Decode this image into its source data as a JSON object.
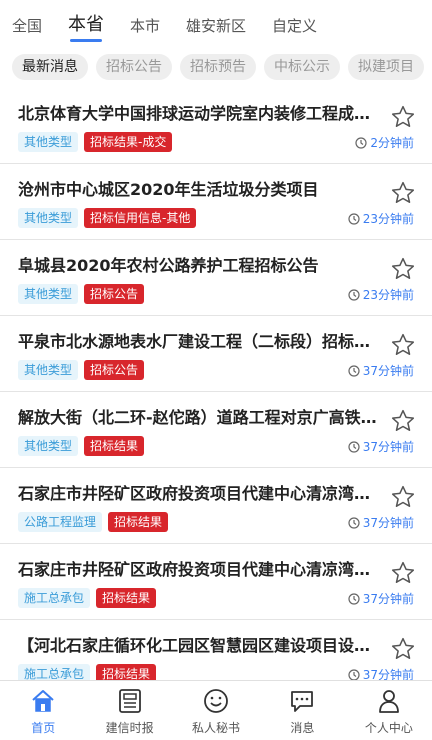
{
  "region_tabs": [
    {
      "label": "全国",
      "active": false
    },
    {
      "label": "本省",
      "active": true
    },
    {
      "label": "本市",
      "active": false
    },
    {
      "label": "雄安新区",
      "active": false
    },
    {
      "label": "自定义",
      "active": false
    }
  ],
  "categories": [
    {
      "label": "最新消息",
      "active": true
    },
    {
      "label": "招标公告",
      "active": false
    },
    {
      "label": "招标预告",
      "active": false
    },
    {
      "label": "中标公示",
      "active": false
    },
    {
      "label": "拟建项目",
      "active": false
    }
  ],
  "items": [
    {
      "title": "北京体育大学中国排球运动学院室内装修工程成交公告",
      "type_tag": "其他类型",
      "status_tag": "招标结果-成交",
      "time": "2分钟前"
    },
    {
      "title": "沧州市中心城区2020年生活垃圾分类项目",
      "type_tag": "其他类型",
      "status_tag": "招标信用信息-其他",
      "time": "23分钟前"
    },
    {
      "title": "阜城县2020年农村公路养护工程招标公告",
      "type_tag": "其他类型",
      "status_tag": "招标公告",
      "time": "23分钟前"
    },
    {
      "title": "平泉市北水源地表水厂建设工程（二标段）招标公告",
      "type_tag": "其他类型",
      "status_tag": "招标公告",
      "time": "37分钟前"
    },
    {
      "title": "解放大街（北二环-赵佗路）道路工程对京广高铁影响评估",
      "type_tag": "其他类型",
      "status_tag": "招标结果",
      "time": "37分钟前"
    },
    {
      "title": "石家庄市井陉矿区政府投资项目代建中心清凉湾项目",
      "type_tag": "公路工程监理",
      "status_tag": "招标结果",
      "time": "37分钟前"
    },
    {
      "title": "石家庄市井陉矿区政府投资项目代建中心清凉湾项目",
      "type_tag": "施工总承包",
      "status_tag": "招标结果",
      "time": "37分钟前"
    },
    {
      "title": "【河北石家庄循环化工园区智慧园区建设项目设计】",
      "type_tag": "施工总承包",
      "status_tag": "招标结果",
      "time": "37分钟前"
    }
  ],
  "bottom_nav": [
    {
      "label": "首页",
      "icon": "home-icon",
      "active": true
    },
    {
      "label": "建信时报",
      "icon": "newspaper-icon",
      "active": false
    },
    {
      "label": "私人秘书",
      "icon": "smile-icon",
      "active": false
    },
    {
      "label": "消息",
      "icon": "chat-icon",
      "active": false
    },
    {
      "label": "个人中心",
      "icon": "user-icon",
      "active": false
    }
  ],
  "colors": {
    "accent": "#3a7cf0",
    "status_red": "#d8262c",
    "type_tag_text": "#3a9cd8"
  }
}
